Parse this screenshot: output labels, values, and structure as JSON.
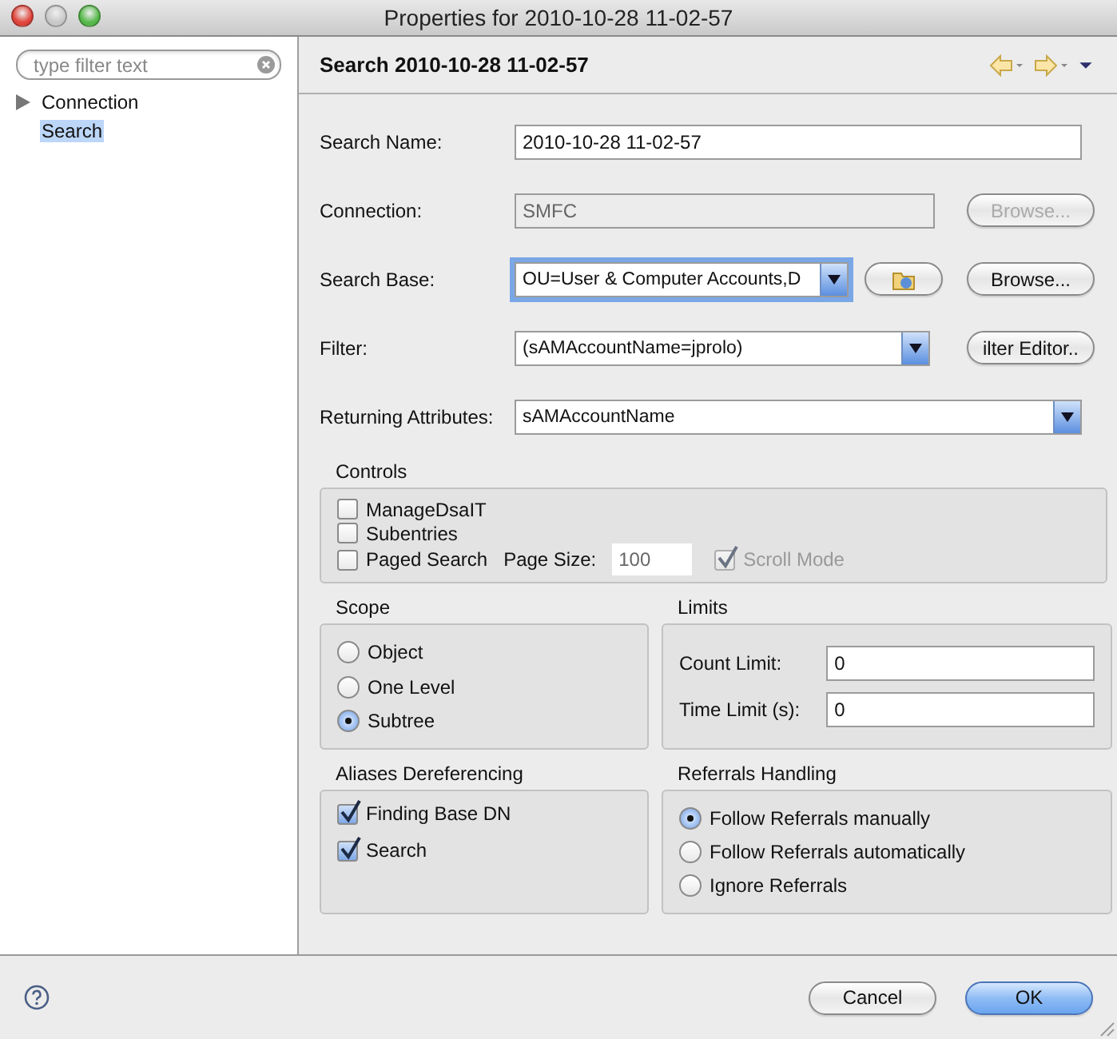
{
  "window": {
    "title": "Properties for 2010-10-28 11-02-57"
  },
  "sidebar": {
    "filter": {
      "placeholder": "type filter text"
    },
    "items": [
      {
        "label": "Connection",
        "kind": "branch",
        "selected": false
      },
      {
        "label": "Search",
        "kind": "leaf",
        "selected": true
      }
    ]
  },
  "panel": {
    "title": "Search 2010-10-28 11-02-57"
  },
  "form": [
    {
      "kind": "text",
      "label": "Search Name:",
      "value": "2010-10-28 11-02-57",
      "disabled": false
    },
    {
      "kind": "text",
      "label": "Connection:",
      "value": "SMFC",
      "disabled": true,
      "button": {
        "label": "Browse...",
        "disabled": true
      }
    },
    {
      "kind": "combo",
      "label": "Search Base:",
      "value": "OU=User & Computer Accounts,D",
      "focused": true,
      "icon_button": true,
      "button": {
        "label": "Browse...",
        "disabled": false
      }
    },
    {
      "kind": "combo",
      "label": "Filter:",
      "value": "(sAMAccountName=jprolo)",
      "focused": false,
      "button": {
        "label": "ilter Editor..",
        "disabled": false
      }
    },
    {
      "kind": "combo",
      "label": "Returning Attributes:",
      "value": "sAMAccountName",
      "focused": false
    }
  ],
  "controls": {
    "title": "Controls",
    "items": [
      {
        "label": "ManageDsaIT",
        "checked": false
      },
      {
        "label": "Subentries",
        "checked": false
      }
    ],
    "paged": {
      "label": "Paged Search",
      "checked": false,
      "page_size_label": "Page Size:",
      "page_size": "100",
      "scroll_mode": {
        "label": "Scroll Mode",
        "checked": true,
        "disabled": true
      }
    }
  },
  "scope": {
    "title": "Scope",
    "options": [
      {
        "label": "Object",
        "selected": false
      },
      {
        "label": "One Level",
        "selected": false
      },
      {
        "label": "Subtree",
        "selected": true
      }
    ]
  },
  "limits": {
    "title": "Limits",
    "fields": [
      {
        "label": "Count Limit:",
        "value": "0"
      },
      {
        "label": "Time Limit (s):",
        "value": "0"
      }
    ]
  },
  "aliases": {
    "title": "Aliases Dereferencing",
    "options": [
      {
        "label": "Finding Base DN",
        "checked": true
      },
      {
        "label": "Search",
        "checked": true
      }
    ]
  },
  "referrals": {
    "title": "Referrals Handling",
    "options": [
      {
        "label": "Follow Referrals manually",
        "selected": true
      },
      {
        "label": "Follow Referrals automatically",
        "selected": false
      },
      {
        "label": "Ignore Referrals",
        "selected": false
      }
    ]
  },
  "footer": {
    "buttons": [
      {
        "label": "Cancel",
        "default": false
      },
      {
        "label": "OK",
        "default": true
      }
    ]
  }
}
